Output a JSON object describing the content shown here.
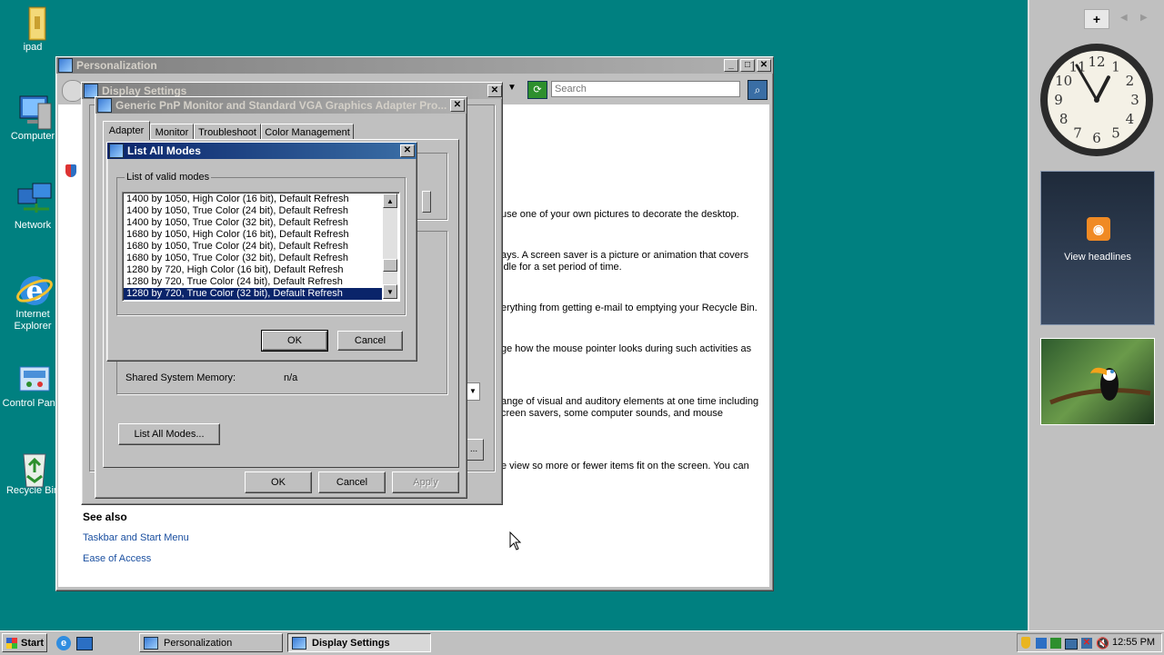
{
  "desktop": {
    "icons": [
      {
        "label": "ipad"
      },
      {
        "label": "Computer"
      },
      {
        "label": "Network"
      },
      {
        "label": "Internet Explorer"
      },
      {
        "label": "Control Panel"
      },
      {
        "label": "Recycle Bin"
      }
    ]
  },
  "personalization": {
    "title": "Personalization",
    "search_placeholder": "Search",
    "descriptions": [
      "use one of your own pictures to decorate the desktop.",
      "ays. A screen saver is a picture or animation that covers",
      "idle for a set period of time.",
      "erything from getting e-mail to emptying your Recycle Bin.",
      "ge how the mouse pointer looks during such activities as",
      "ange of visual and auditory elements at one time including",
      "creen savers, some computer sounds, and mouse",
      "e view so more or fewer items fit on the screen. You can"
    ],
    "see_also": "See also",
    "links": [
      "Taskbar and Start Menu",
      "Ease of Access"
    ]
  },
  "display_settings": {
    "title": "Display Settings"
  },
  "adapter_dialog": {
    "title": "Generic PnP Monitor and Standard VGA Graphics Adapter Pro...",
    "tabs": [
      "Adapter",
      "Monitor",
      "Troubleshoot",
      "Color Management"
    ],
    "shared_memory_label": "Shared System Memory:",
    "shared_memory_value": "n/a",
    "list_all_modes_button": "List All Modes...",
    "ok": "OK",
    "cancel": "Cancel",
    "apply": "Apply"
  },
  "list_modes_dialog": {
    "title": "List All Modes",
    "group_label": "List of valid modes",
    "modes": [
      "1400 by 1050, High Color (16 bit), Default Refresh",
      "1400 by 1050, True Color (24 bit), Default Refresh",
      "1400 by 1050, True Color (32 bit), Default Refresh",
      "1680 by 1050, High Color (16 bit), Default Refresh",
      "1680 by 1050, True Color (24 bit), Default Refresh",
      "1680 by 1050, True Color (32 bit), Default Refresh",
      "1280 by 720, High Color (16 bit), Default Refresh",
      "1280 by 720, True Color (24 bit), Default Refresh",
      "1280 by 720, True Color (32 bit), Default Refresh"
    ],
    "selected_index": 8,
    "ok": "OK",
    "cancel": "Cancel"
  },
  "sidebar": {
    "add_label": "+",
    "clock": {
      "hour": 12,
      "minute": 55
    },
    "feed_label": "View headlines"
  },
  "taskbar": {
    "start_label": "Start",
    "tasks": [
      {
        "label": "Personalization"
      },
      {
        "label": "Display Settings"
      }
    ],
    "time": "12:55 PM"
  },
  "colors": {
    "desktop": "#008080",
    "title_active": "#0a246a",
    "selection": "#0a246a"
  }
}
